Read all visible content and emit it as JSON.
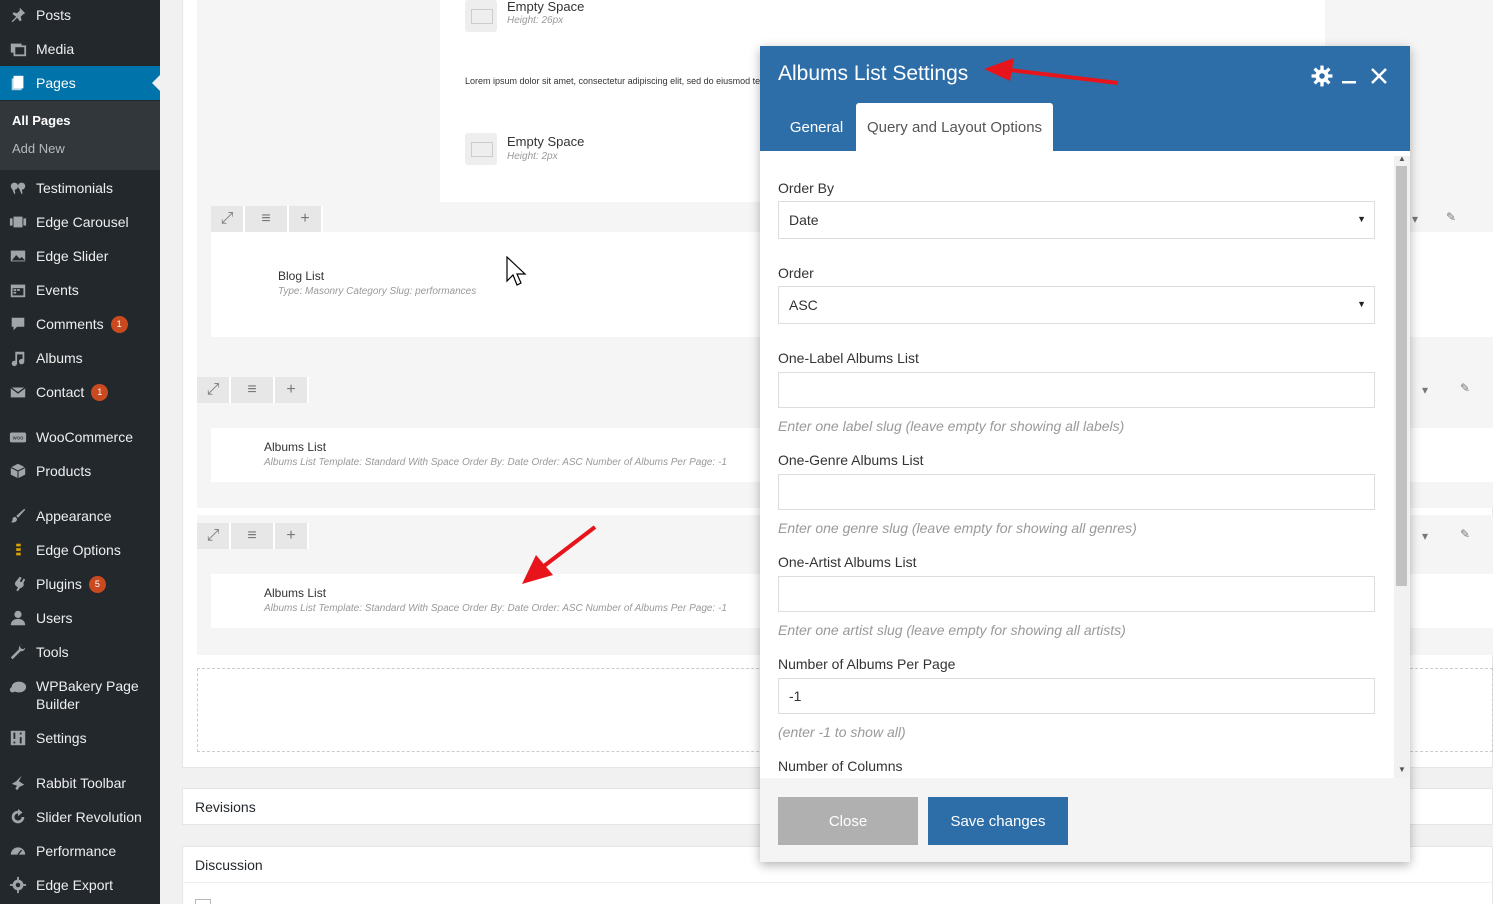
{
  "sidebar": {
    "items": [
      {
        "label": "Posts",
        "icon": "pushpin-icon"
      },
      {
        "label": "Media",
        "icon": "media-icon"
      },
      {
        "label": "Pages",
        "icon": "pages-icon",
        "active": true
      },
      {
        "label": "Testimonials",
        "icon": "quote-icon"
      },
      {
        "label": "Edge Carousel",
        "icon": "carousel-icon"
      },
      {
        "label": "Edge Slider",
        "icon": "slider-icon"
      },
      {
        "label": "Events",
        "icon": "calendar-icon"
      },
      {
        "label": "Comments",
        "icon": "comment-icon",
        "badge": "1"
      },
      {
        "label": "Albums",
        "icon": "music-note-icon"
      },
      {
        "label": "Contact",
        "icon": "mail-icon",
        "badge": "1"
      },
      {
        "label": "WooCommerce",
        "icon": "woo-icon"
      },
      {
        "label": "Products",
        "icon": "box-icon"
      },
      {
        "label": "Appearance",
        "icon": "brush-icon"
      },
      {
        "label": "Edge Options",
        "icon": "edge-icon"
      },
      {
        "label": "Plugins",
        "icon": "plug-icon",
        "badge": "5"
      },
      {
        "label": "Users",
        "icon": "user-icon"
      },
      {
        "label": "Tools",
        "icon": "wrench-icon"
      },
      {
        "label": "WPBakery Page Builder",
        "line1": "WPBakery Page",
        "line2": "Builder",
        "icon": "wpbakery-icon"
      },
      {
        "label": "Settings",
        "icon": "settings-icon"
      },
      {
        "label": "Rabbit Toolbar",
        "icon": "rabbit-icon"
      },
      {
        "label": "Slider Revolution",
        "icon": "refresh-icon"
      },
      {
        "label": "Performance",
        "icon": "gauge-icon"
      },
      {
        "label": "Edge Export",
        "icon": "gear-icon"
      }
    ],
    "submenu": [
      {
        "label": "All Pages",
        "current": true
      },
      {
        "label": "Add New"
      }
    ]
  },
  "builder": {
    "empty_space_1": {
      "title": "Empty Space",
      "sub": "Height: 26px"
    },
    "lorem_text": "Lorem ipsum dolor sit amet, consectetur adipiscing elit, sed do eiusmod te",
    "empty_space_2": {
      "title": "Empty Space",
      "sub": "Height: 2px"
    },
    "blog_list": {
      "title": "Blog List",
      "sub": "Type: Masonry  Category Slug: performances"
    },
    "albums_list_1": {
      "title": "Albums List",
      "sub": "Albums List Template: Standard With Space  Order By: Date  Order: ASC  Number of Albums Per Page: -1"
    },
    "albums_list_2": {
      "title": "Albums List",
      "sub": "Albums List Template: Standard With Space  Order By: Date  Order: ASC  Number of Albums Per Page: -1"
    },
    "tool_icons": {
      "fullscreen": "⤢",
      "drag": "≡",
      "add": "+"
    }
  },
  "meta_boxes": {
    "revisions": "Revisions",
    "discussion": "Discussion"
  },
  "modal": {
    "title": "Albums List Settings",
    "tabs": [
      "General",
      "Query and Layout Options"
    ],
    "active_tab": "Query and Layout Options",
    "fields": {
      "order_by": {
        "label": "Order By",
        "value": "Date"
      },
      "order": {
        "label": "Order",
        "value": "ASC"
      },
      "one_label": {
        "label": "One-Label Albums List",
        "value": "",
        "help": "Enter one label slug (leave empty for showing all labels)"
      },
      "one_genre": {
        "label": "One-Genre Albums List",
        "value": "",
        "help": "Enter one genre slug (leave empty for showing all genres)"
      },
      "one_artist": {
        "label": "One-Artist Albums List",
        "value": "",
        "help": "Enter one artist slug (leave empty for showing all artists)"
      },
      "per_page": {
        "label": "Number of Albums Per Page",
        "value": "-1",
        "help": "(enter -1 to show all)"
      },
      "columns": {
        "label": "Number of Columns"
      }
    },
    "buttons": {
      "close": "Close",
      "save": "Save changes"
    }
  },
  "colors": {
    "sidebar_bg": "#23282d",
    "active_menu": "#0073aa",
    "modal_header": "#2d6ea8",
    "badge": "#ca4a1f",
    "annotation_arrow": "#e8141b"
  }
}
